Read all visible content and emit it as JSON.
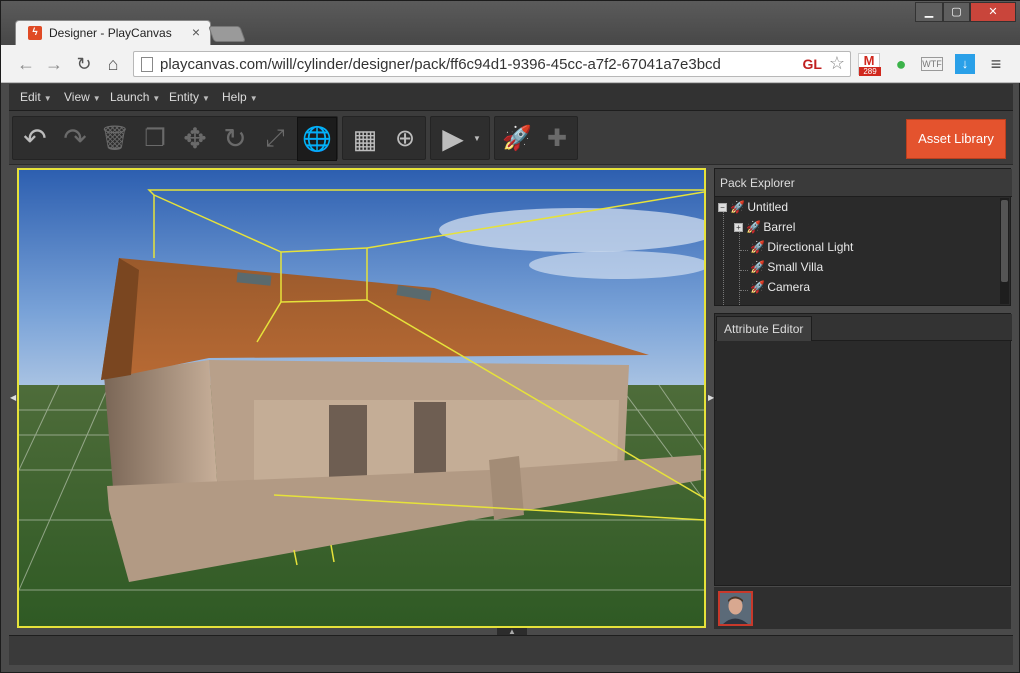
{
  "browser": {
    "tab_title": "Designer - PlayCanvas",
    "tab_close": "×",
    "url": "playcanvas.com/will/cylinder/designer/pack/ff6c94d1-9396-45cc-a7f2-67041a7e3bcd",
    "gl_badge": "GL",
    "mail_count": "289"
  },
  "menu": [
    {
      "label": "Edit"
    },
    {
      "label": "View"
    },
    {
      "label": "Launch"
    },
    {
      "label": "Entity"
    },
    {
      "label": "Help"
    }
  ],
  "toolbar": {
    "asset_library_label": "Asset Library"
  },
  "pack_explorer": {
    "title": "Pack Explorer",
    "nodes": [
      {
        "label": "Untitled"
      },
      {
        "label": "Barrel"
      },
      {
        "label": "Directional Light"
      },
      {
        "label": "Small Villa"
      },
      {
        "label": "Camera"
      }
    ]
  },
  "attribute_editor": {
    "tab_label": "Attribute Editor"
  },
  "colors": {
    "accent": "#e4532e",
    "selection": "#e6e23a"
  }
}
